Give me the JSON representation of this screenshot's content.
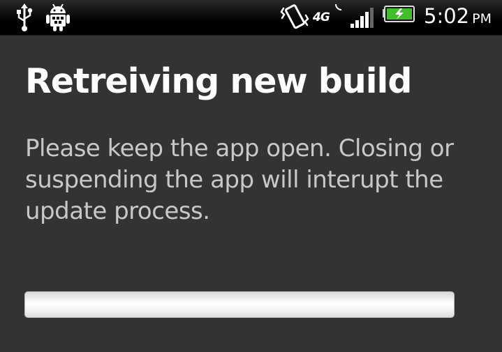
{
  "status_bar": {
    "icons": [
      "usb-icon",
      "android-debug-icon",
      "vibrate-icon",
      "signal-icon",
      "battery-charging-icon"
    ],
    "network_type": "4G",
    "time": "5:02",
    "ampm": "PM",
    "battery_color": "#3fbf2a"
  },
  "dialog": {
    "title": "Retreiving new build",
    "message": "Please keep the app open. Closing or suspending the app will interupt the update process.",
    "progress": 0
  },
  "colors": {
    "background": "#333333",
    "title": "#ffffff",
    "message": "#c8c8c8"
  }
}
